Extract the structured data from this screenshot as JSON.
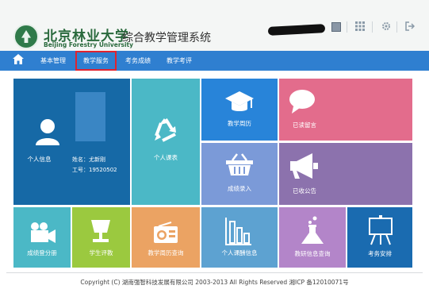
{
  "header": {
    "university_cn": "北京林业大学",
    "university_en": "Beijing Forestry University",
    "system_title": "综合教学管理系统",
    "icons": [
      "user-avatar",
      "grid-icon",
      "gear-icon",
      "exit-icon"
    ]
  },
  "nav": {
    "home_icon": "home-icon",
    "items": [
      {
        "label": "基本管理"
      },
      {
        "label": "教学服务",
        "active": true
      },
      {
        "label": "考务成绩"
      },
      {
        "label": "教学考评"
      }
    ]
  },
  "profile": {
    "label": "个人信息",
    "name_line": "姓名：尤新刚",
    "id_line": "工号：19520502"
  },
  "tiles": {
    "personal_course": "个人课表",
    "teaching_calendar": "教学周历",
    "read_messages": "已读留言",
    "grade_entry": "成绩录入",
    "received_notices": "已收公告",
    "grade_registration": "成绩登分册",
    "student_evaluation": "学生评教",
    "course_calendar_query": "教学周历查询",
    "personal_pay_info": "个人课酬信息",
    "lab_info_query": "教研信息查询",
    "exam_schedule": "考务安排"
  },
  "colors": {
    "nav_blue": "#2f7fd0",
    "profile_blue": "#1669a6",
    "teal": "#4bb8c6",
    "blue": "#2884d9",
    "pink": "#e36c8c",
    "periwinkle": "#7b9ad8",
    "purple": "#8c72ad",
    "lime": "#9bc93f",
    "orange": "#eba363",
    "slate_blue": "#5da2d1",
    "lavender": "#b385c9",
    "dark_blue": "#1a6bb0",
    "active_border": "#e0232f"
  },
  "footer": {
    "copyright": "Copyright (C) 湖南强智科技发展有限公司 2003-2013 All Rights Reserved 湘ICP 备12010071号"
  }
}
